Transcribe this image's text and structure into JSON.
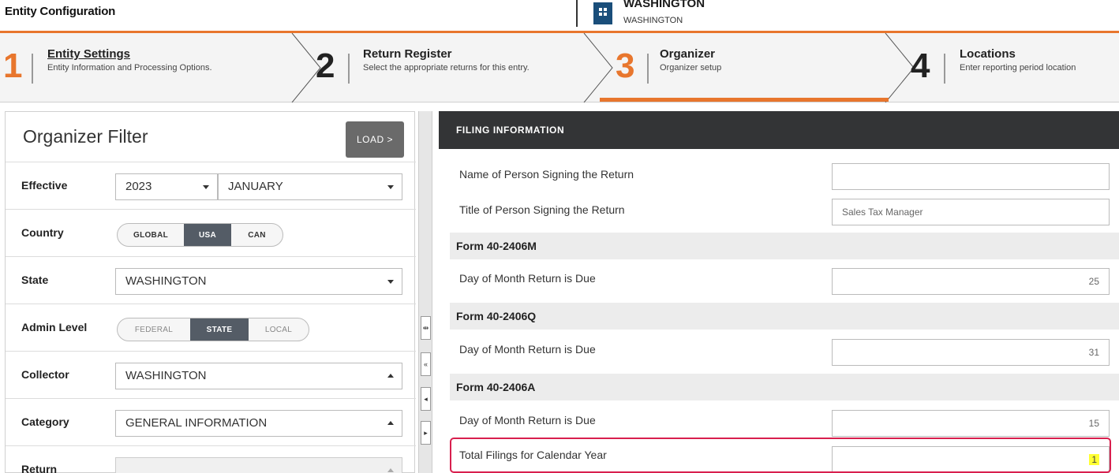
{
  "app": {
    "title": "Entity Configuration",
    "entity_name": "WASHINGTON",
    "entity_sub": "WASHINGTON"
  },
  "steps": [
    {
      "number": "1",
      "title": "Entity Settings",
      "desc": "Entity Information and Processing Options.",
      "color": "#e8762d"
    },
    {
      "number": "2",
      "title": "Return Register",
      "desc": "Select the appropriate returns for this entry.",
      "color": "#222222"
    },
    {
      "number": "3",
      "title": "Organizer",
      "desc": "Organizer setup",
      "color": "#e8762d"
    },
    {
      "number": "4",
      "title": "Locations",
      "desc": "Enter reporting period location",
      "color": "#222222"
    }
  ],
  "filter": {
    "title": "Organizer Filter",
    "load_label": "LOAD >",
    "effective_label": "Effective",
    "effective_year": "2023",
    "effective_month": "JANUARY",
    "country_label": "Country",
    "country_options": [
      "GLOBAL",
      "USA",
      "CAN"
    ],
    "country_selected": "USA",
    "state_label": "State",
    "state_value": "WASHINGTON",
    "admin_label": "Admin Level",
    "admin_options": [
      "FEDERAL",
      "STATE",
      "LOCAL"
    ],
    "admin_selected": "STATE",
    "collector_label": "Collector",
    "collector_value": "WASHINGTON",
    "category_label": "Category",
    "category_value": "GENERAL INFORMATION",
    "return_label": "Return",
    "return_value": ""
  },
  "form": {
    "section_title": "FILING INFORMATION",
    "signer_name_label": "Name of Person Signing the Return",
    "signer_name_value": "",
    "signer_title_label": "Title of Person Signing the Return",
    "signer_title_value": "Sales Tax Manager",
    "group_m": "Form 40-2406M",
    "due_m_label": "Day of Month Return is Due",
    "due_m_value": "25",
    "group_q": "Form 40-2406Q",
    "due_q_label": "Day of Month Return is Due",
    "due_q_value": "31",
    "group_a": "Form 40-2406A",
    "due_a_label": "Day of Month Return is Due",
    "due_a_value": "15",
    "total_label": "Total Filings for Calendar Year",
    "total_value": "1"
  },
  "colors": {
    "accent": "#e8762d",
    "header_dark": "#333436",
    "highlight_border": "#d81f4e",
    "highlight_fill": "#ffff33",
    "toggle_active": "#545c66"
  }
}
